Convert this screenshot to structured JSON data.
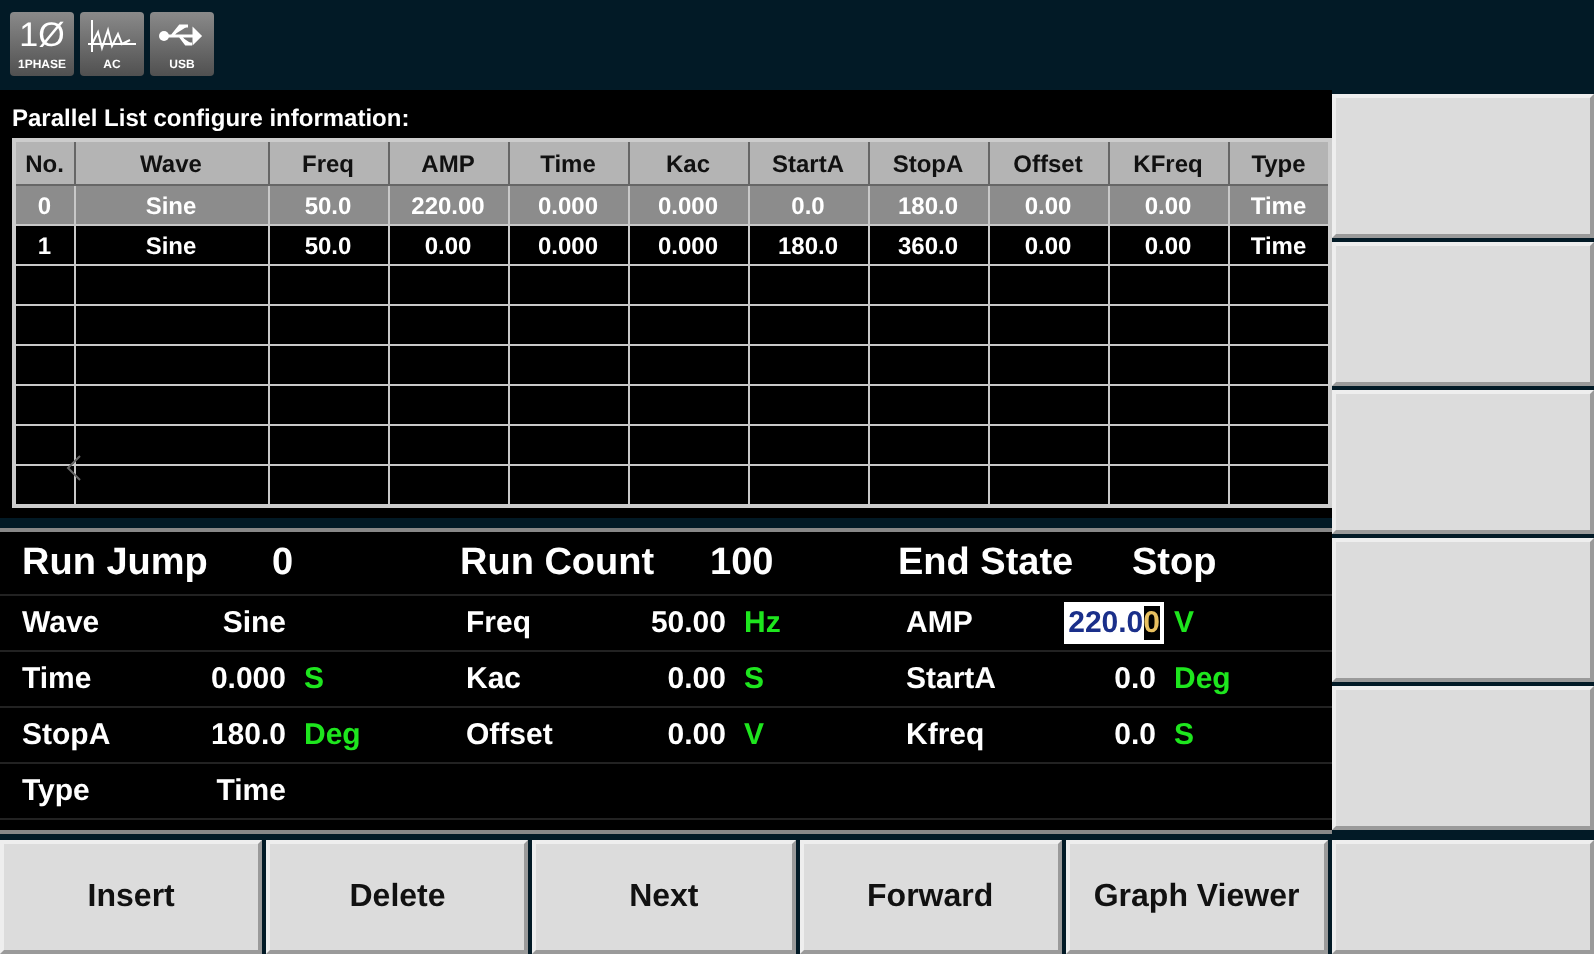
{
  "status_icons": [
    {
      "kind": "phase",
      "symbol": "1Ø",
      "label": "1PHASE"
    },
    {
      "kind": "ac",
      "label": "AC"
    },
    {
      "kind": "usb",
      "label": "USB"
    }
  ],
  "list": {
    "title": "Parallel List configure information:",
    "columns": [
      "No.",
      "Wave",
      "Freq",
      "AMP",
      "Time",
      "Kac",
      "StartA",
      "StopA",
      "Offset",
      "KFreq",
      "Type"
    ],
    "rows": [
      {
        "selected": true,
        "cells": [
          "0",
          "Sine",
          "50.0",
          "220.00",
          "0.000",
          "0.000",
          "0.0",
          "180.0",
          "0.00",
          "0.00",
          "Time"
        ]
      },
      {
        "selected": false,
        "cells": [
          "1",
          "Sine",
          "50.0",
          "0.00",
          "0.000",
          "0.000",
          "180.0",
          "360.0",
          "0.00",
          "0.00",
          "Time"
        ]
      }
    ]
  },
  "summary": [
    {
      "label": "Run Jump",
      "value": "0"
    },
    {
      "label": "Run Count",
      "value": "100"
    },
    {
      "label": "End State",
      "value": "Stop"
    }
  ],
  "params": [
    [
      {
        "label": "Wave",
        "value": "Sine"
      },
      {
        "label": "Freq",
        "value": "50.00",
        "unit": "Hz"
      },
      {
        "label": "AMP",
        "value": "220.00",
        "unit": "V",
        "kind": "editing"
      }
    ],
    [
      {
        "label": "Time",
        "value": "0.000",
        "unit": "S"
      },
      {
        "label": "Kac",
        "value": "0.00",
        "unit": "S"
      },
      {
        "label": "StartA",
        "value": "0.0",
        "unit": "Deg"
      }
    ],
    [
      {
        "label": "StopA",
        "value": "180.0",
        "unit": "Deg"
      },
      {
        "label": "Offset",
        "value": "0.00",
        "unit": "V"
      },
      {
        "label": "Kfreq",
        "value": "0.0",
        "unit": "S"
      }
    ],
    [
      {
        "label": "Type",
        "value": "Time"
      }
    ]
  ],
  "bottom_buttons": [
    "Insert",
    "Delete",
    "Next",
    "Forward",
    "Graph Viewer"
  ]
}
